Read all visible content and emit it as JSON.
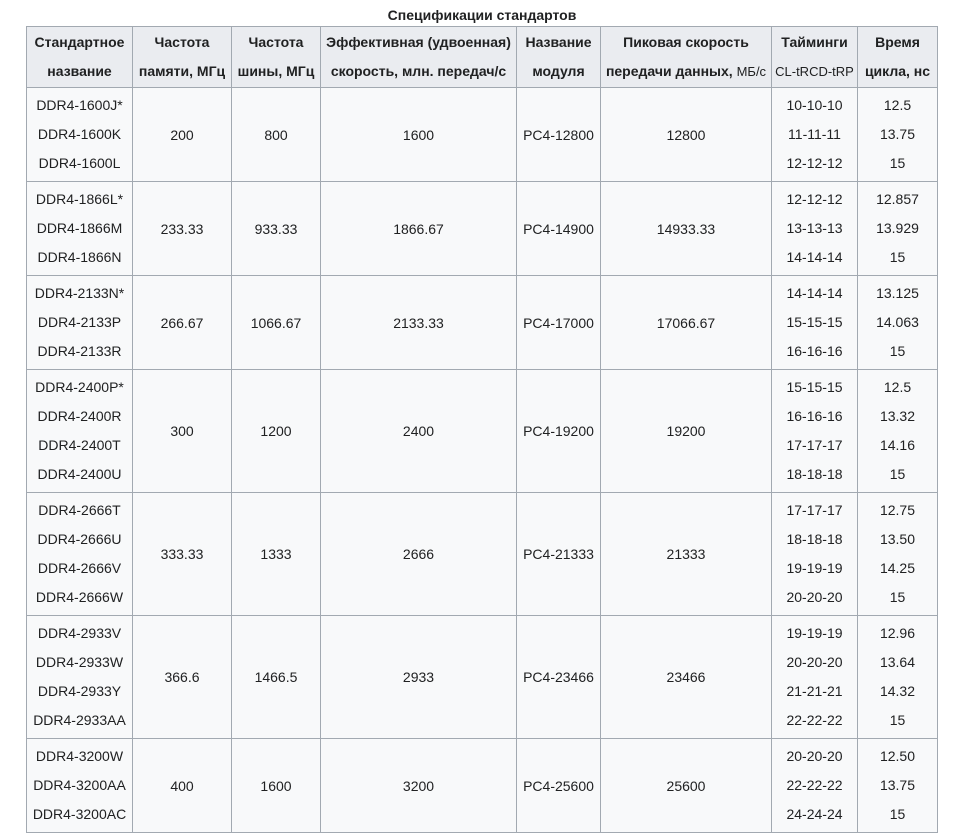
{
  "caption": "Спецификации стандартов",
  "headers": [
    {
      "l1": "Стандартное",
      "l2": "название",
      "l2_sub": ""
    },
    {
      "l1": "Частота",
      "l2": "памяти, МГц",
      "l2_sub": ""
    },
    {
      "l1": "Частота",
      "l2": "шины, МГц",
      "l2_sub": ""
    },
    {
      "l1": "Эффективная (удвоенная)",
      "l2": "скорость, млн. передач/с",
      "l2_sub": ""
    },
    {
      "l1": "Название",
      "l2": "модуля",
      "l2_sub": ""
    },
    {
      "l1": "Пиковая скорость",
      "l2": "передачи данных, ",
      "l2_sub": "МБ/с"
    },
    {
      "l1": "Тайминги",
      "l2": "",
      "l2_sub": "CL-tRCD-tRP"
    },
    {
      "l1": "Время",
      "l2": "цикла, нс",
      "l2_sub": ""
    }
  ],
  "groups": [
    {
      "names": [
        "DDR4-1600J*",
        "DDR4-1600K",
        "DDR4-1600L"
      ],
      "mem": "200",
      "bus": "800",
      "eff": "1600",
      "module": "PC4-12800",
      "peak": "12800",
      "timings": [
        "10-10-10",
        "11-11-11",
        "12-12-12"
      ],
      "cycle": [
        "12.5",
        "13.75",
        "15"
      ]
    },
    {
      "names": [
        "DDR4-1866L*",
        "DDR4-1866M",
        "DDR4-1866N"
      ],
      "mem": "233.33",
      "bus": "933.33",
      "eff": "1866.67",
      "module": "PC4-14900",
      "peak": "14933.33",
      "timings": [
        "12-12-12",
        "13-13-13",
        "14-14-14"
      ],
      "cycle": [
        "12.857",
        "13.929",
        "15"
      ]
    },
    {
      "names": [
        "DDR4-2133N*",
        "DDR4-2133P",
        "DDR4-2133R"
      ],
      "mem": "266.67",
      "bus": "1066.67",
      "eff": "2133.33",
      "module": "PC4-17000",
      "peak": "17066.67",
      "timings": [
        "14-14-14",
        "15-15-15",
        "16-16-16"
      ],
      "cycle": [
        "13.125",
        "14.063",
        "15"
      ]
    },
    {
      "names": [
        "DDR4-2400P*",
        "DDR4-2400R",
        "DDR4-2400T",
        "DDR4-2400U"
      ],
      "mem": "300",
      "bus": "1200",
      "eff": "2400",
      "module": "PC4-19200",
      "peak": "19200",
      "timings": [
        "15-15-15",
        "16-16-16",
        "17-17-17",
        "18-18-18"
      ],
      "cycle": [
        "12.5",
        "13.32",
        "14.16",
        "15"
      ]
    },
    {
      "names": [
        "DDR4-2666T",
        "DDR4-2666U",
        "DDR4-2666V",
        "DDR4-2666W"
      ],
      "mem": "333.33",
      "bus": "1333",
      "eff": "2666",
      "module": "PC4-21333",
      "peak": "21333",
      "timings": [
        "17-17-17",
        "18-18-18",
        "19-19-19",
        "20-20-20"
      ],
      "cycle": [
        "12.75",
        "13.50",
        "14.25",
        "15"
      ]
    },
    {
      "names": [
        "DDR4-2933V",
        "DDR4-2933W",
        "DDR4-2933Y",
        "DDR4-2933AA"
      ],
      "mem": "366.6",
      "bus": "1466.5",
      "eff": "2933",
      "module": "PC4-23466",
      "peak": "23466",
      "timings": [
        "19-19-19",
        "20-20-20",
        "21-21-21",
        "22-22-22"
      ],
      "cycle": [
        "12.96",
        "13.64",
        "14.32",
        "15"
      ]
    },
    {
      "names": [
        "DDR4-3200W",
        "DDR4-3200AA",
        "DDR4-3200AC"
      ],
      "mem": "400",
      "bus": "1600",
      "eff": "3200",
      "module": "PC4-25600",
      "peak": "25600",
      "timings": [
        "20-20-20",
        "22-22-22",
        "24-24-24"
      ],
      "cycle": [
        "12.50",
        "13.75",
        "15"
      ]
    }
  ]
}
